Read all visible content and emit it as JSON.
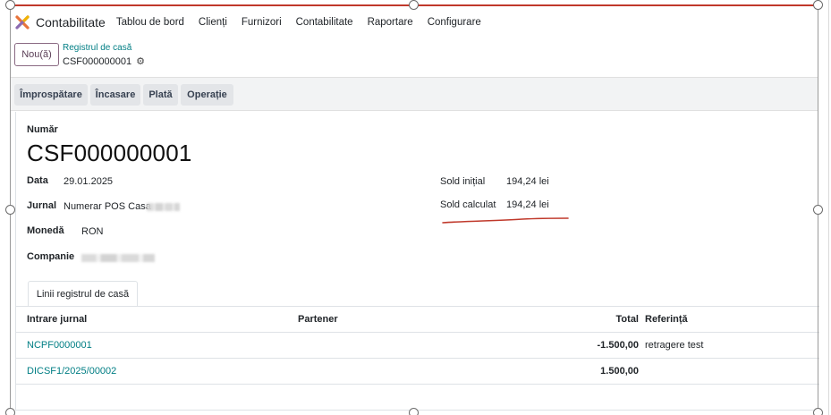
{
  "nav": {
    "app_name": "Contabilitate",
    "items": [
      "Tablou de bord",
      "Clienți",
      "Furnizori",
      "Contabilitate",
      "Raportare",
      "Configurare"
    ]
  },
  "control_panel": {
    "new_button": "Nou(ă)",
    "breadcrumb_parent": "Registrul de casă",
    "breadcrumb_current": "CSF000000001"
  },
  "actions": [
    "Împrospătare",
    "Încasare",
    "Plată",
    "Operație"
  ],
  "form": {
    "number_label": "Număr",
    "number_value": "CSF000000001",
    "date_label": "Data",
    "date_value": "29.01.2025",
    "journal_label": "Jurnal",
    "journal_value": "Numerar POS Casa",
    "currency_label": "Monedă",
    "currency_value": "RON",
    "company_label": "Companie",
    "opening_balance_label": "Sold inițial",
    "opening_balance_value": "194,24 lei",
    "computed_balance_label": "Sold calculat",
    "computed_balance_value": "194,24 lei"
  },
  "tabs": {
    "lines_tab": "Linii registrul de casă"
  },
  "table": {
    "columns": {
      "entry": "Intrare jurnal",
      "partner": "Partener",
      "total": "Total",
      "reference": "Referință"
    },
    "rows": [
      {
        "entry": "NCPF0000001",
        "partner": "",
        "total": "-1.500,00",
        "reference": "retragere test"
      },
      {
        "entry": "DICSF1/2025/00002",
        "partner": "",
        "total": "1.500,00",
        "reference": ""
      }
    ]
  },
  "colors": {
    "accent": "#017e84",
    "primary_btn_border": "#8a6a83",
    "annotation_red": "#c0392b"
  }
}
